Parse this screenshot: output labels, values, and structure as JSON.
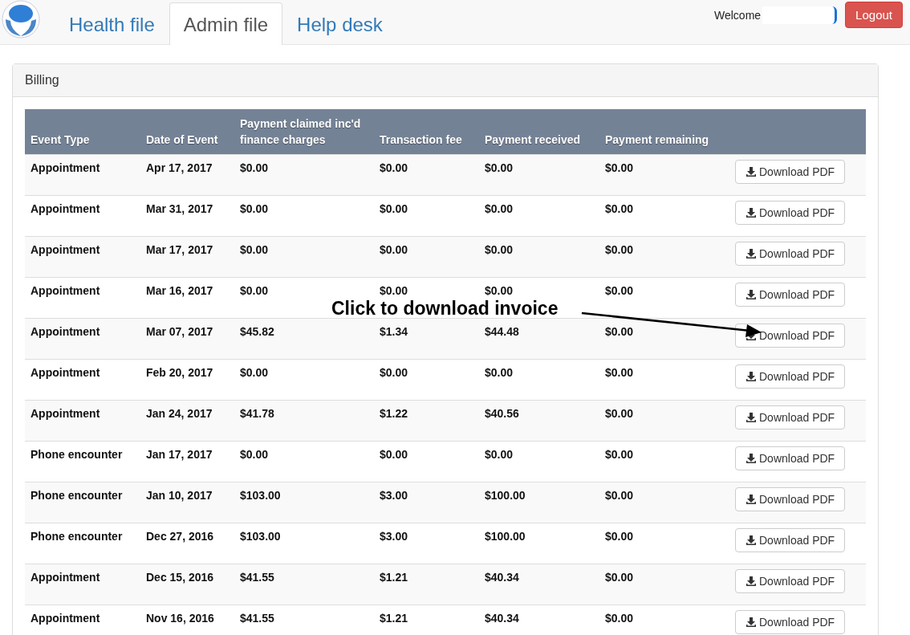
{
  "nav": {
    "tabs": [
      {
        "label": "Health file",
        "selected": false
      },
      {
        "label": "Admin file",
        "selected": true
      },
      {
        "label": "Help desk",
        "selected": false
      }
    ],
    "welcome": "Welcome",
    "logout": "Logout"
  },
  "panel": {
    "title": "Billing"
  },
  "table": {
    "columns": [
      "Event Type",
      "Date of Event",
      "Payment claimed inc'd finance charges",
      "Transaction fee",
      "Payment received",
      "Payment remaining"
    ],
    "rows": [
      {
        "cells": [
          "Appointment",
          "Apr 17, 2017",
          "$0.00",
          "$0.00",
          "$0.00",
          "$0.00"
        ],
        "action": "Download PDF"
      },
      {
        "cells": [
          "Appointment",
          "Mar 31, 2017",
          "$0.00",
          "$0.00",
          "$0.00",
          "$0.00"
        ],
        "action": "Download PDF"
      },
      {
        "cells": [
          "Appointment",
          "Mar 17, 2017",
          "$0.00",
          "$0.00",
          "$0.00",
          "$0.00"
        ],
        "action": "Download PDF"
      },
      {
        "cells": [
          "Appointment",
          "Mar 16, 2017",
          "$0.00",
          "$0.00",
          "$0.00",
          "$0.00"
        ],
        "action": "Download PDF"
      },
      {
        "cells": [
          "Appointment",
          "Mar 07, 2017",
          "$45.82",
          "$1.34",
          "$44.48",
          "$0.00"
        ],
        "action": "Download PDF"
      },
      {
        "cells": [
          "Appointment",
          "Feb 20, 2017",
          "$0.00",
          "$0.00",
          "$0.00",
          "$0.00"
        ],
        "action": "Download PDF"
      },
      {
        "cells": [
          "Appointment",
          "Jan 24, 2017",
          "$41.78",
          "$1.22",
          "$40.56",
          "$0.00"
        ],
        "action": "Download PDF"
      },
      {
        "cells": [
          "Phone encounter",
          "Jan 17, 2017",
          "$0.00",
          "$0.00",
          "$0.00",
          "$0.00"
        ],
        "action": "Download PDF"
      },
      {
        "cells": [
          "Phone encounter",
          "Jan 10, 2017",
          "$103.00",
          "$3.00",
          "$100.00",
          "$0.00"
        ],
        "action": "Download PDF"
      },
      {
        "cells": [
          "Phone encounter",
          "Dec 27, 2016",
          "$103.00",
          "$3.00",
          "$100.00",
          "$0.00"
        ],
        "action": "Download PDF"
      },
      {
        "cells": [
          "Appointment",
          "Dec 15, 2016",
          "$41.55",
          "$1.21",
          "$40.34",
          "$0.00"
        ],
        "action": "Download PDF"
      },
      {
        "cells": [
          "Appointment",
          "Nov 16, 2016",
          "$41.55",
          "$1.21",
          "$40.34",
          "$0.00"
        ],
        "action": "Download PDF"
      }
    ]
  },
  "annotation": {
    "text": "Click to download invoice"
  }
}
